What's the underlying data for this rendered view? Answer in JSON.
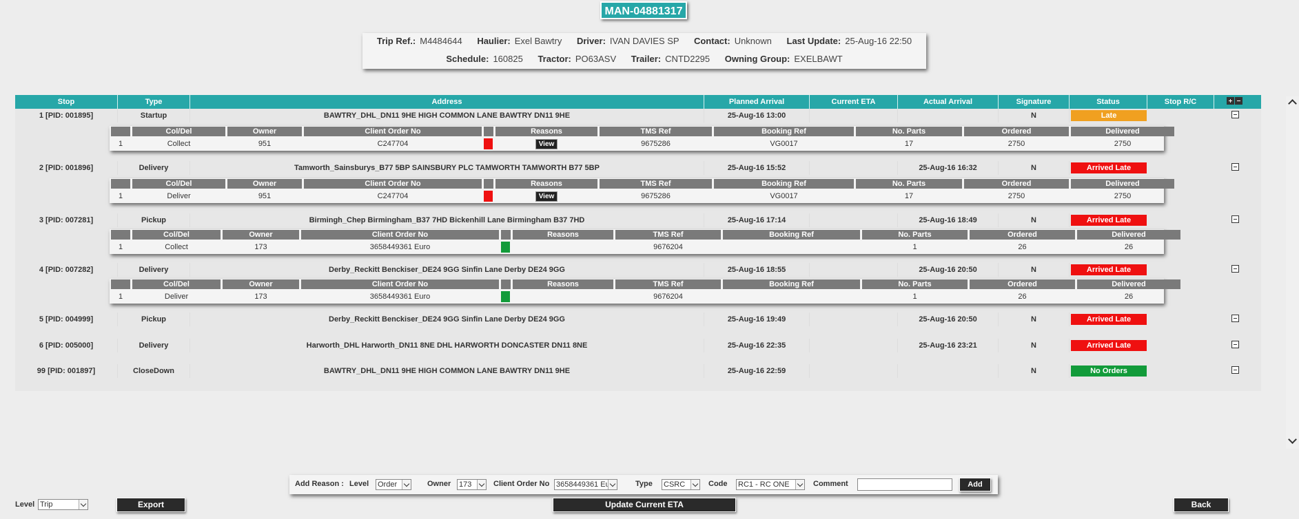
{
  "title": "MAN-04881317",
  "trip": {
    "trip_ref_label": "Trip Ref.:",
    "trip_ref": "M4484644",
    "haulier_label": "Haulier:",
    "haulier": "Exel Bawtry",
    "driver_label": "Driver:",
    "driver": "IVAN DAVIES SP",
    "contact_label": "Contact:",
    "contact": "Unknown",
    "last_update_label": "Last Update:",
    "last_update": "25-Aug-16 22:50",
    "schedule_label": "Schedule:",
    "schedule": "160825",
    "tractor_label": "Tractor:",
    "tractor": "PO63ASV",
    "trailer_label": "Trailer:",
    "trailer": "CNTD2295",
    "owning_group_label": "Owning Group:",
    "owning_group": "EXELBAWT"
  },
  "columns": {
    "stop": "Stop",
    "type": "Type",
    "address": "Address",
    "planned": "Planned Arrival",
    "eta": "Current ETA",
    "actual": "Actual Arrival",
    "signature": "Signature",
    "status": "Status",
    "rc": "Stop R/C"
  },
  "sub_columns": {
    "coldel": "Col/Del",
    "owner": "Owner",
    "client_order": "Client Order No",
    "reasons": "Reasons",
    "tms": "TMS Ref",
    "booking": "Booking Ref",
    "parts": "No. Parts",
    "ordered": "Ordered",
    "delivered": "Delivered"
  },
  "stops": [
    {
      "stop": "1  [PID: 001895]",
      "type": "Startup",
      "address": "BAWTRY_DHL_DN11 9HE HIGH COMMON LANE BAWTRY DN11 9HE",
      "planned": "25-Aug-16 13:00",
      "eta": "",
      "actual": "",
      "signature": "N",
      "status": "Late",
      "status_color": "#f0a020"
    },
    {
      "stop": "2  [PID: 001896]",
      "type": "Delivery",
      "address": "Tamworth_Sainsburys_B77 5BP SAINSBURY PLC TAMWORTH TAMWORTH B77 5BP",
      "planned": "25-Aug-16 15:52",
      "eta": "",
      "actual": "25-Aug-16 16:32",
      "signature": "N",
      "status": "Arrived Late",
      "status_color": "#ef1010"
    },
    {
      "stop": "3  [PID: 007281]",
      "type": "Pickup",
      "address": "Birmingh_Chep Birmingham_B37 7HD Bickenhill Lane Birmingham B37 7HD",
      "planned": "25-Aug-16 17:14",
      "eta": "",
      "actual": "25-Aug-16 18:49",
      "signature": "N",
      "status": "Arrived Late",
      "status_color": "#ef1010"
    },
    {
      "stop": "4  [PID: 007282]",
      "type": "Delivery",
      "address": "Derby_Reckitt Benckiser_DE24 9GG Sinfin Lane Derby DE24 9GG",
      "planned": "25-Aug-16 18:55",
      "eta": "",
      "actual": "25-Aug-16 20:50",
      "signature": "N",
      "status": "Arrived Late",
      "status_color": "#ef1010"
    },
    {
      "stop": "5  [PID: 004999]",
      "type": "Pickup",
      "address": "Derby_Reckitt Benckiser_DE24 9GG Sinfin Lane Derby DE24 9GG",
      "planned": "25-Aug-16 19:49",
      "eta": "",
      "actual": "25-Aug-16 20:50",
      "signature": "N",
      "status": "Arrived Late",
      "status_color": "#ef1010"
    },
    {
      "stop": "6  [PID: 005000]",
      "type": "Delivery",
      "address": "Harworth_DHL Harworth_DN11 8NE DHL HARWORTH DONCASTER DN11 8NE",
      "planned": "25-Aug-16 22:35",
      "eta": "",
      "actual": "25-Aug-16 23:21",
      "signature": "N",
      "status": "Arrived Late",
      "status_color": "#ef1010"
    },
    {
      "stop": "99  [PID: 001897]",
      "type": "CloseDown",
      "address": "BAWTRY_DHL_DN11 9HE HIGH COMMON LANE BAWTRY DN11 9HE",
      "planned": "25-Aug-16 22:59",
      "eta": "",
      "actual": "",
      "signature": "N",
      "status": "No Orders",
      "status_color": "#129b3a"
    }
  ],
  "orders": [
    {
      "n": "1",
      "coldel": "Collect",
      "owner": "951",
      "client_order": "C247704",
      "flag": "red",
      "reasons": "View",
      "tms": "9675286",
      "booking": "VG0017",
      "parts": "17",
      "ordered": "2750",
      "delivered": "2750"
    },
    {
      "n": "1",
      "coldel": "Deliver",
      "owner": "951",
      "client_order": "C247704",
      "flag": "red",
      "reasons": "View",
      "tms": "9675286",
      "booking": "VG0017",
      "parts": "17",
      "ordered": "2750",
      "delivered": "2750"
    },
    {
      "n": "1",
      "coldel": "Collect",
      "owner": "173",
      "client_order": "3658449361 Euro",
      "flag": "green",
      "reasons": "",
      "tms": "9676204",
      "booking": "",
      "parts": "1",
      "ordered": "26",
      "delivered": "26"
    },
    {
      "n": "1",
      "coldel": "Deliver",
      "owner": "173",
      "client_order": "3658449361 Euro",
      "flag": "green",
      "reasons": "",
      "tms": "9676204",
      "booking": "",
      "parts": "1",
      "ordered": "26",
      "delivered": "26"
    }
  ],
  "reason_bar": {
    "add_reason_label": "Add Reason :",
    "level_label": "Level",
    "level_value": "Order",
    "owner_label": "Owner",
    "owner_value": "173",
    "client_order_label": "Client Order No",
    "client_order_value": "3658449361 Euro",
    "type_label": "Type",
    "type_value": "CSRC",
    "code_label": "Code",
    "code_value": "RC1 - RC ONE",
    "comment_label": "Comment",
    "comment_value": "",
    "add_label": "Add"
  },
  "footer": {
    "level_label": "Level",
    "level_value": "Trip",
    "export_label": "Export",
    "update_eta_label": "Update Current ETA",
    "back_label": "Back"
  }
}
